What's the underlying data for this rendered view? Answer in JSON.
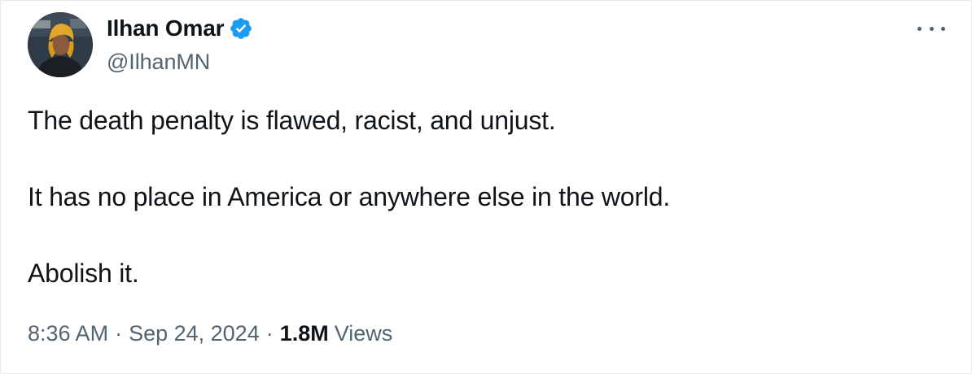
{
  "author": {
    "display_name": "Ilhan Omar",
    "handle": "@IlhanMN",
    "verified": true,
    "verified_color": "#1d9bf0"
  },
  "tweet": {
    "paragraphs": [
      "The death penalty is flawed, racist, and unjust.",
      "It has no place in America or anywhere else in the world.",
      "Abolish it."
    ]
  },
  "meta": {
    "time": "8:36 AM",
    "separator": "·",
    "date": "Sep 24, 2024",
    "views_count": "1.8M",
    "views_label": "Views"
  },
  "icons": {
    "more": "more-options-icon",
    "verified": "verified-badge-icon"
  },
  "colors": {
    "text_primary": "#0f1419",
    "text_secondary": "#536471",
    "background": "#ffffff"
  }
}
